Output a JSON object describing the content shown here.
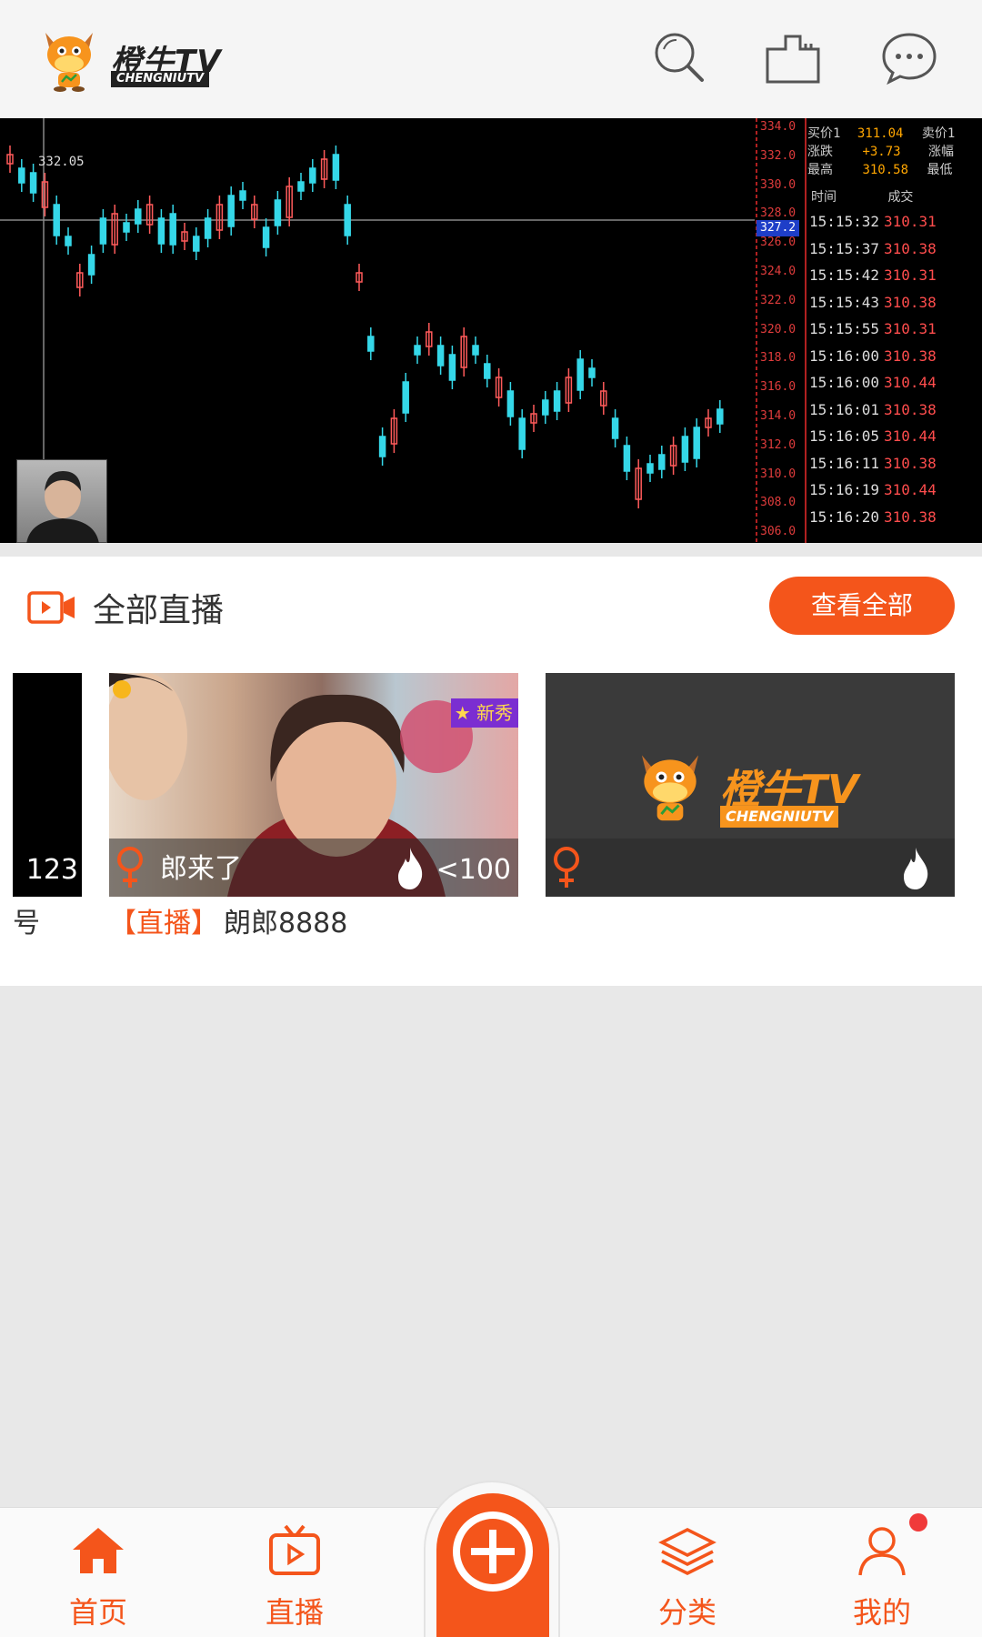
{
  "app": {
    "logo_cn": "橙牛TV",
    "logo_en": "CHENGNIUTV",
    "accent_color": "#f4551b"
  },
  "topbar": {
    "icons": [
      "search-icon",
      "building-icon",
      "message-icon"
    ]
  },
  "player": {
    "high_label": "332.05",
    "price_tag": "327.2",
    "price_axis": [
      "334.0",
      "332.0",
      "330.0",
      "328.0",
      "326.0",
      "324.0",
      "322.0",
      "320.0",
      "318.0",
      "316.0",
      "314.0",
      "312.0",
      "310.0",
      "308.0",
      "306.0"
    ],
    "quote": {
      "buy1_label": "买价1",
      "buy1_value": "311.04",
      "sell1_label": "卖价1",
      "change_label": "涨跌",
      "change_value": "+3.73",
      "change_pct_label": "涨幅",
      "high_label": "最高",
      "high_value": "310.58",
      "low_label": "最低"
    },
    "ticker_headers": {
      "time": "时间",
      "price": "成交"
    },
    "ticks": [
      {
        "time": "15:15:32",
        "price": "310.31"
      },
      {
        "time": "15:15:37",
        "price": "310.38"
      },
      {
        "time": "15:15:42",
        "price": "310.31"
      },
      {
        "time": "15:15:43",
        "price": "310.38"
      },
      {
        "time": "15:15:55",
        "price": "310.31"
      },
      {
        "time": "15:16:00",
        "price": "310.38"
      },
      {
        "time": "15:16:00",
        "price": "310.44"
      },
      {
        "time": "15:16:01",
        "price": "310.38"
      },
      {
        "time": "15:16:05",
        "price": "310.44"
      },
      {
        "time": "15:16:11",
        "price": "310.38"
      },
      {
        "time": "15:16:19",
        "price": "310.44"
      },
      {
        "time": "15:16:20",
        "price": "310.38"
      }
    ]
  },
  "live": {
    "section_title": "全部直播",
    "view_all_label": "查看全部",
    "cards": [
      {
        "count": "123",
        "caption": "号"
      },
      {
        "name": "郎来了",
        "count": "<100",
        "badge": "新秀",
        "caption_tag": "【直播】",
        "caption_name": "朗郎8888"
      },
      {
        "thumb_logo_cn": "橙牛TV",
        "thumb_logo_en": "CHENGNIUTV"
      }
    ]
  },
  "bottom_nav": {
    "items": [
      {
        "label": "首页",
        "icon": "home-icon"
      },
      {
        "label": "直播",
        "icon": "tv-icon"
      },
      {
        "label": "分类",
        "icon": "layers-icon"
      },
      {
        "label": "我的",
        "icon": "user-icon"
      }
    ],
    "center_icon": "plus-icon",
    "notification_dot": true
  }
}
